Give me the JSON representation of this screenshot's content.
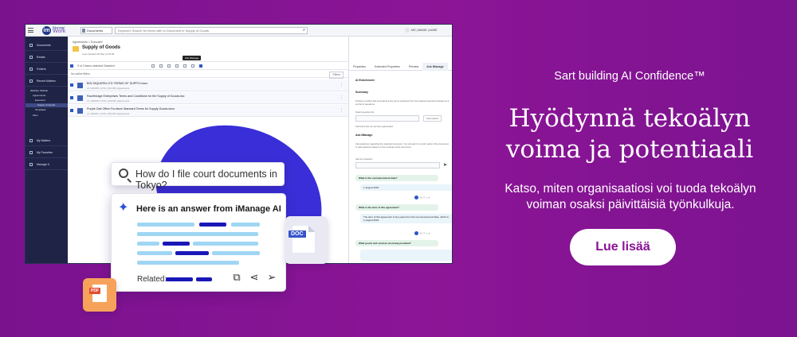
{
  "colors": {
    "background": "#8a1595",
    "cta_text": "#8b1096",
    "sidebar": "#1f2446",
    "accent_blue": "#2b4fd6"
  },
  "app": {
    "header": {
      "logo_mark": "im",
      "logo_line1": "iManage",
      "logo_line2": "Work",
      "scope": "Documents",
      "search_placeholder": "Keyword: Search for terms with in Document in Supply of Goods",
      "user": "MG  |  IMAGE  |  ACME"
    },
    "sidebar": {
      "items": [
        "Documents",
        "Emails",
        "Folders",
        "Recent Matters",
        "My Matters",
        "My Favorites",
        "Manage It"
      ],
      "tree": [
        "IMAGE | IMAGE",
        "Agreements",
        "Executed",
        "Supply of Goods",
        "Templates",
        "Files"
      ]
    },
    "main": {
      "breadcrumb": "Agreements  >  Executed",
      "folder_title": "Supply of Goods",
      "folder_sub": "Last Updated 28 May at 09:05",
      "upload_label": "Upload File",
      "selection": "3 of 3 items selected   Deselect",
      "tooltip": "Ask iManage",
      "filter_label": "No active filters",
      "filter_button": "Filters",
      "documents": [
        {
          "title": "BOLTAQUERN LTD TERMS OF SUPPLY.docx",
          "meta": "v1 | 402345 | 12:51 | 15/3 KB | Agreements"
        },
        {
          "title": "Facetheage Enterprises Terms and Conditions for the Supply of Goods.doc",
          "meta": "v1 | 402346 | 14:51 | 12/6 KB | Agreements"
        },
        {
          "title": "Purple Oak Office Furniture Standard Terms for Supply Goods.docx",
          "meta": "v1 | 402347 | 14:51 | 15/2 KB | Agreements"
        }
      ]
    },
    "right_panel": {
      "tabs": [
        "Properties",
        "Extended Properties",
        "Preview",
        "Ask iManage"
      ],
      "section_ai": "AI Enrichment",
      "section_summary": "Summary",
      "summary_help": "Produce a rather that summarizes key terms extracted from the selected document based on a set list of questions.",
      "summary_select": "Select question list",
      "summary_button": "Summarize",
      "summary_empty": "Summary has not yet been generated.",
      "section_ask": "Ask iManage",
      "ask_help": "Ask questions regarding the selected document. You can ask it to return parts of the document, or ask questions based on the contents of the document.",
      "ask_label": "Ask any question",
      "qa": [
        {
          "q": "What is the commencement date?",
          "a": "1 August 2023"
        },
        {
          "q": "What is the term of this agreement?",
          "a": "The term of this agreement is two years from the Commencement Date, which is 1 August 2024."
        },
        {
          "q": "What goods and services are being provided?",
          "a": ""
        }
      ]
    }
  },
  "overlay": {
    "search_query": "How do I file court documents in Tokyo?",
    "answer_title": "Here is an answer from iManage AI",
    "related_label": "Related:",
    "doc_badge": "DOC",
    "pdf_badge": "PDF"
  },
  "promo": {
    "tagline": "Sart building AI Confidence™",
    "headline_line1": "Hyödynnä tekoälyn",
    "headline_line2": "voima ja potentiaali",
    "body_line1": "Katso, miten organisaatiosi voi tuoda tekoälyn",
    "body_line2": "voiman osaksi päivittäisiä työnkulkuja.",
    "cta_label": "Lue lisää"
  }
}
